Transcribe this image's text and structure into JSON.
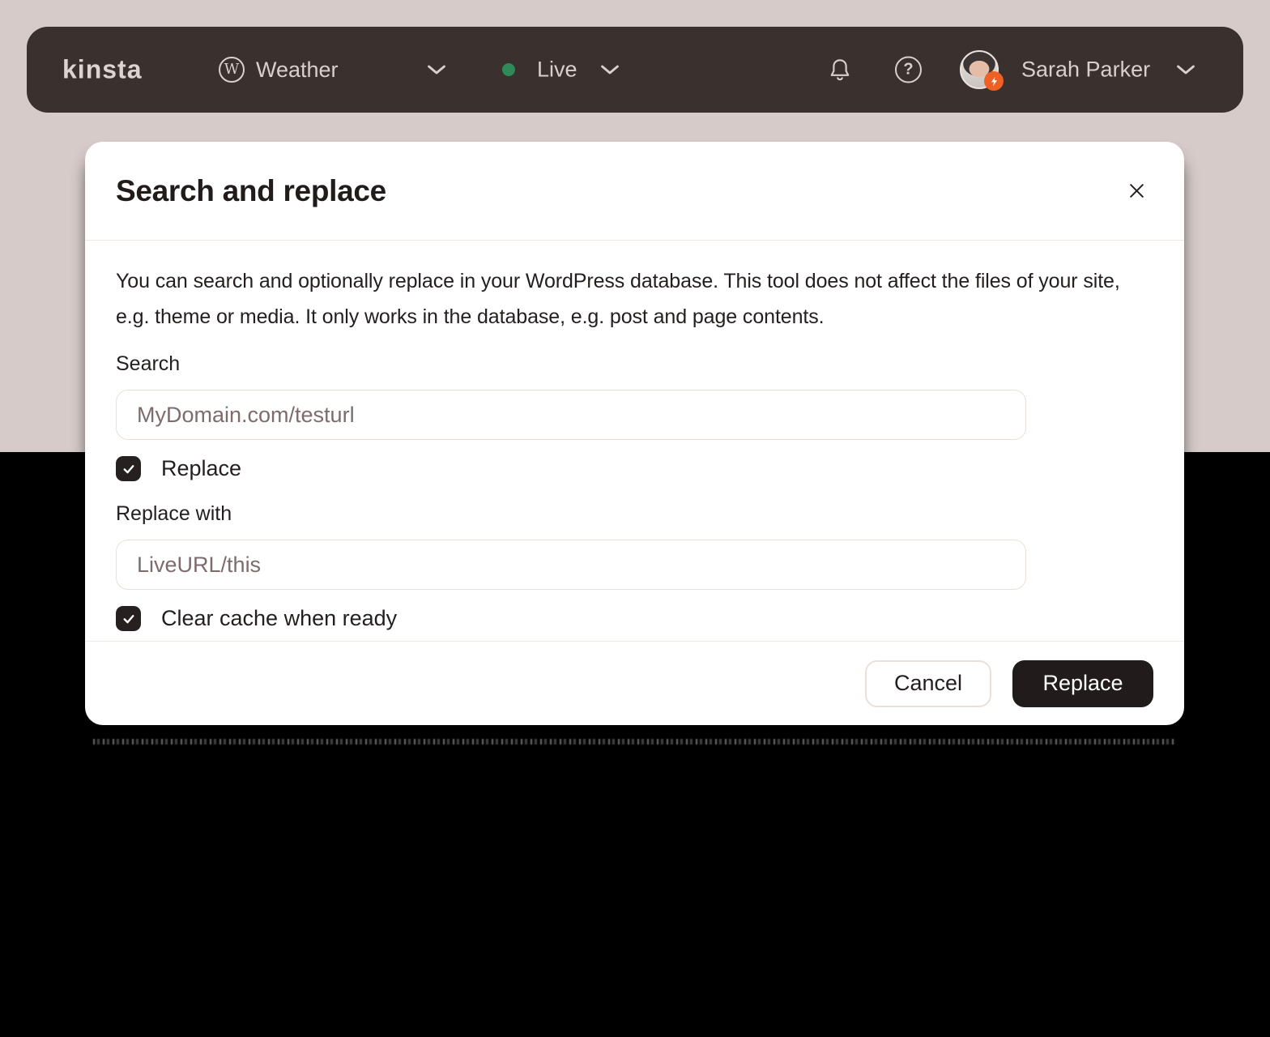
{
  "header": {
    "logo": "kinsta",
    "site_selector": {
      "label": "Weather"
    },
    "env_selector": {
      "label": "Live",
      "status": "online"
    },
    "user": {
      "name": "Sarah Parker"
    },
    "icons": {
      "wordpress_glyph": "W",
      "help_glyph": "?"
    }
  },
  "modal": {
    "title": "Search and replace",
    "description": "You can search and optionally replace in your WordPress database. This tool does not affect the files of your site, e.g. theme or media. It only works in the database, e.g. post and page contents.",
    "search": {
      "label": "Search",
      "placeholder": "MyDomain.com/testurl"
    },
    "replace_checkbox": {
      "label": "Replace",
      "checked": true
    },
    "replace_with": {
      "label": "Replace with",
      "placeholder": "LiveURL/this"
    },
    "clear_cache_checkbox": {
      "label": "Clear cache when ready",
      "checked": true
    },
    "footer": {
      "cancel_label": "Cancel",
      "replace_label": "Replace"
    }
  },
  "colors": {
    "page_background_top": "#d7cbc9",
    "page_background_bottom": "#000000",
    "header_background": "#3a302e",
    "header_text": "#d9d0cd",
    "status_green": "#2e8a56",
    "notification_red": "#dd1f1f",
    "badge_orange": "#ee6123",
    "primary_button": "#211c1b",
    "input_border": "#ecdfd8",
    "placeholder_text": "#7e6c6c"
  }
}
